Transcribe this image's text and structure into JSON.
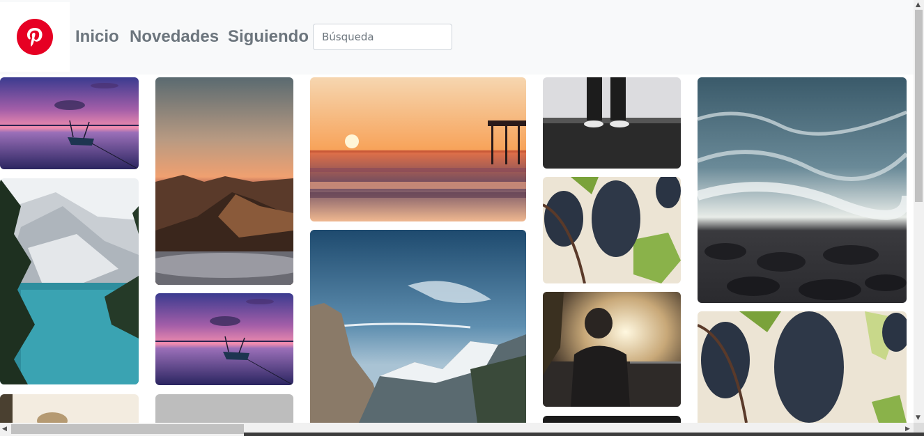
{
  "header": {
    "logo_name": "pinterest-logo",
    "nav": [
      {
        "label": "Inicio"
      },
      {
        "label": "Novedades"
      },
      {
        "label": "Siguiendo"
      }
    ],
    "search_placeholder": "Búsqueda"
  },
  "colors": {
    "brand": "#e60023",
    "nav_text": "#6c757d",
    "header_bg": "#f8f9fa"
  },
  "pins": [
    {
      "subject": "lake-sunset-boat"
    },
    {
      "subject": "snowy-mountain-lake"
    },
    {
      "subject": "partial-image"
    },
    {
      "subject": "mountain-sunset-clouds"
    },
    {
      "subject": "lake-sunset-boat"
    },
    {
      "subject": "placeholder-gray"
    },
    {
      "subject": "ocean-sunset-pier"
    },
    {
      "subject": "yosemite-valley"
    },
    {
      "subject": "person-feet-gravel"
    },
    {
      "subject": "grapes-vine"
    },
    {
      "subject": "person-sunset-silhouette"
    },
    {
      "subject": "partial-image-dark"
    },
    {
      "subject": "ocean-waves-rocks"
    },
    {
      "subject": "grapes-vine"
    }
  ]
}
